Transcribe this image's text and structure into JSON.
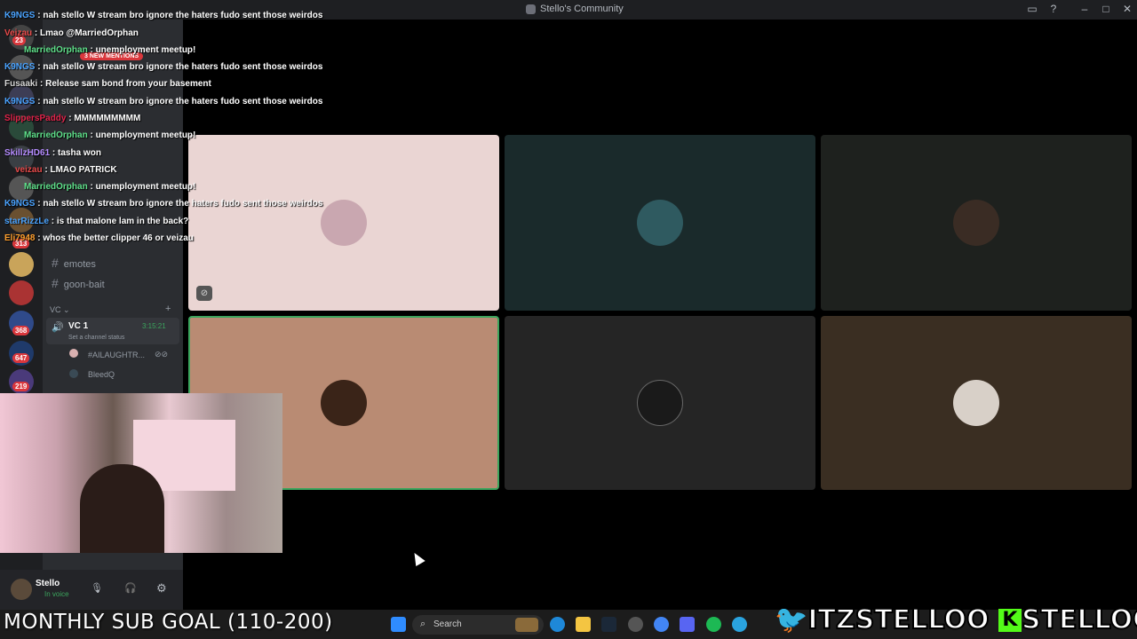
{
  "window": {
    "title": "Stello's Community"
  },
  "chat": [
    {
      "user": "K9NGS",
      "text": " : nah stello W stream bro ignore the haters fudo sent those weirdos",
      "color": "#4aa3ff"
    },
    {
      "user": "Veizau",
      "text": " : Lmao @MarriedOrphan",
      "color": "#e84a4a"
    },
    {
      "user": "MarriedOrphan",
      "text": " : unemployment meetup!",
      "color": "#5fe08a"
    },
    {
      "user": "K9NGS",
      "text": " : nah stello W stream bro ignore the haters fudo sent those weirdos",
      "color": "#4aa3ff"
    },
    {
      "user": "Fusaaki",
      "text": " : Release sam bond from your basement",
      "color": "#d7d7d7"
    },
    {
      "user": "K9NGS",
      "text": " : nah stello W stream bro ignore the haters fudo sent those weirdos",
      "color": "#4aa3ff"
    },
    {
      "user": "SlippersPaddy",
      "text": " : MMMMMMMMM",
      "color": "#e0234a"
    },
    {
      "user": "MarriedOrphan",
      "text": " : unemployment meetup!",
      "color": "#5fe08a"
    },
    {
      "user": "SkillzHD61",
      "text": " : tasha won",
      "color": "#b58cff"
    },
    {
      "user": "veizau",
      "text": " : LMAO PATRICK",
      "color": "#e84a4a"
    },
    {
      "user": "MarriedOrphan",
      "text": " : unemployment meetup!",
      "color": "#5fe08a"
    },
    {
      "user": "K9NGS",
      "text": " : nah stello W stream bro ignore the haters fudo sent those weirdos",
      "color": "#4aa3ff"
    },
    {
      "user": "starRizzLe",
      "text": " : is that malone lam in the back?",
      "color": "#4aa3ff"
    },
    {
      "user": "Eli7948",
      "text": " : whos the better clipper 46 or veizau",
      "color": "#ff9f2e"
    }
  ],
  "mentions_pill": "3 NEW MENTIONS",
  "channels": {
    "items": [
      "emotes",
      "goon-bait"
    ],
    "category_vc": "VC",
    "voice_channel": "VC 1",
    "voice_timer": "3:15:21",
    "channel_status": "Set a channel status",
    "voice_members": [
      "#AILAUGHTR...",
      "BleedQ"
    ]
  },
  "guild_badges": [
    "23",
    "313",
    "368",
    "647",
    "219"
  ],
  "user": {
    "name": "Stello",
    "status": "In voice"
  },
  "taskbar": {
    "search_label": "Search",
    "goal_text": "MONTHLY SUB GOAL (110-200)"
  },
  "socials": {
    "twitter": "ITZSTELLOO",
    "kick": "STELLOOO"
  },
  "colors": {
    "tile1": "#ead5d3",
    "tile2": "#1a2a2b",
    "tile3": "#1e211e",
    "tile4": "#b98b73",
    "tile5": "#252525",
    "tile6": "#3a2e22",
    "speaking_border": "#3ba55d"
  }
}
